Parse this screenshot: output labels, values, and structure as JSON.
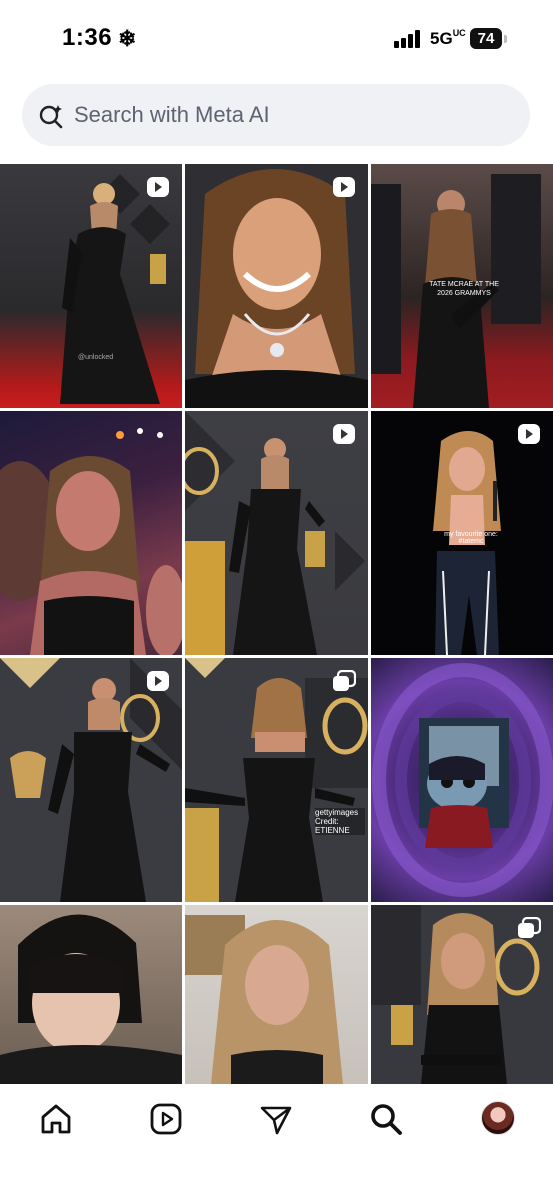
{
  "status": {
    "time": "1:36",
    "network": "5G",
    "network_suffix": "UC",
    "battery": "74"
  },
  "search": {
    "placeholder": "Search with Meta AI"
  },
  "grid": {
    "tiles": [
      {
        "caption": "@unlocked",
        "badge": "reel"
      },
      {
        "caption": "",
        "badge": "reel"
      },
      {
        "caption": "TATE MCRAE AT THE 2026 GRAMMYS",
        "badge": ""
      },
      {
        "caption": "",
        "badge": ""
      },
      {
        "caption": "",
        "badge": "reel"
      },
      {
        "caption": "my favourite one: #tatemc",
        "badge": "reel"
      },
      {
        "caption": "",
        "badge": "reel"
      },
      {
        "caption": "gettyimages Credit: ETIENNE",
        "badge": "carousel"
      },
      {
        "caption": "",
        "badge": ""
      },
      {
        "caption": "",
        "badge": ""
      },
      {
        "caption": "",
        "badge": ""
      },
      {
        "caption": "",
        "badge": "carousel"
      }
    ]
  },
  "nav": {
    "items": [
      "home-icon",
      "reels-icon",
      "messages-icon",
      "search-icon",
      "profile-avatar"
    ]
  },
  "colors": {
    "search_bg": "#eff1f5",
    "placeholder_text": "#5d6470"
  }
}
